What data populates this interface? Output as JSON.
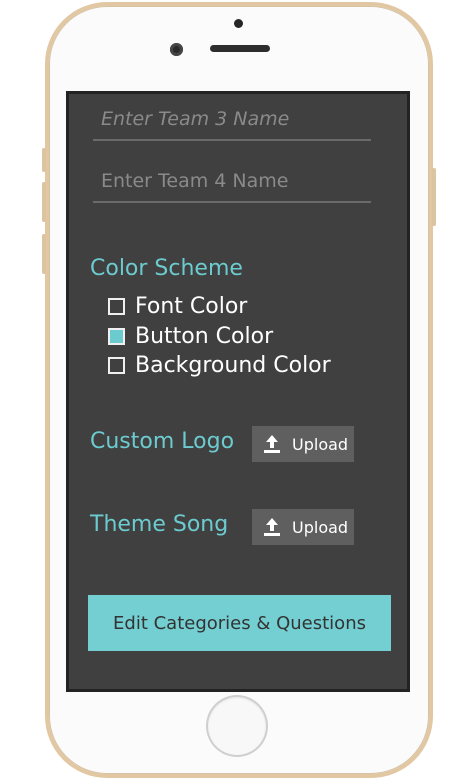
{
  "form": {
    "team3_placeholder": "Enter Team 3 Name",
    "team4_placeholder": "Enter Team 4 Name"
  },
  "color_scheme": {
    "title": "Color Scheme",
    "options": [
      {
        "label": "Font Color",
        "checked": false
      },
      {
        "label": "Button Color",
        "checked": true
      },
      {
        "label": "Background Color",
        "checked": false
      }
    ]
  },
  "custom_logo": {
    "title": "Custom Logo",
    "upload_label": "Upload",
    "icon": "upload-icon"
  },
  "theme_song": {
    "title": "Theme Song",
    "upload_label": "Upload",
    "icon": "upload-icon"
  },
  "actions": {
    "edit_label": "Edit Categories & Questions"
  },
  "colors": {
    "accent": "#6ccbcf",
    "button_bg": "#74cfd2",
    "screen_bg": "#404040",
    "upload_bg": "#5f5f5f"
  }
}
